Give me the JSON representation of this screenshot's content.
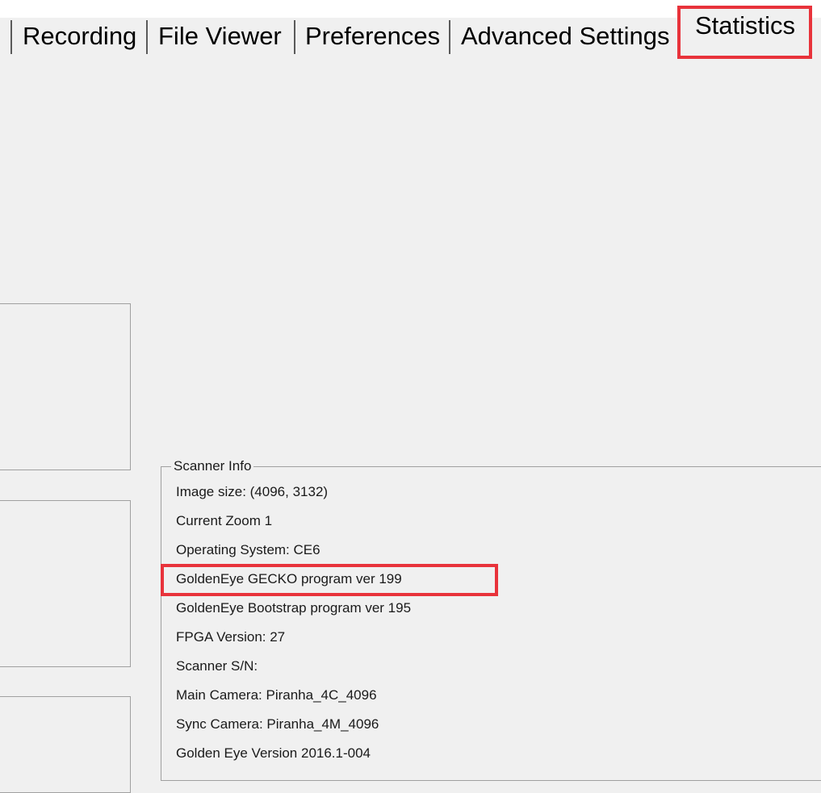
{
  "tabs": [
    {
      "label": "Recording",
      "active": false
    },
    {
      "label": "File Viewer",
      "active": false
    },
    {
      "label": "Preferences",
      "active": false
    },
    {
      "label": "Advanced Settings",
      "active": false
    },
    {
      "label": "Statistics",
      "active": true
    }
  ],
  "scanner_info": {
    "title": "Scanner Info",
    "lines": [
      "Image size:  (4096, 3132)",
      "Current Zoom 1",
      "Operating System: CE6",
      "GoldenEye GECKO program ver 199",
      "GoldenEye Bootstrap program ver 195",
      "FPGA Version: 27",
      "Scanner S/N:",
      "Main Camera: Piranha_4C_4096",
      "Sync Camera: Piranha_4M_4096",
      "Golden Eye Version  2016.1-004"
    ]
  },
  "colors": {
    "background": "#f0f0f0",
    "highlight": "#e8333b",
    "border": "#a0a0a0"
  }
}
